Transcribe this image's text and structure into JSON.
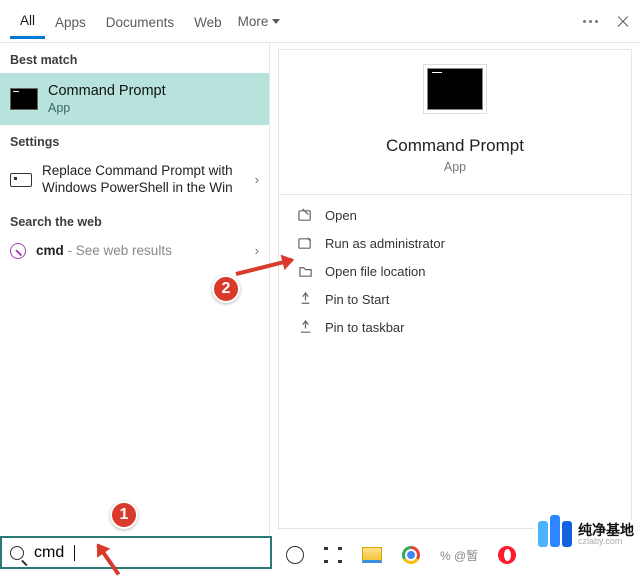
{
  "tabs": {
    "all": "All",
    "apps": "Apps",
    "documents": "Documents",
    "web": "Web",
    "more": "More"
  },
  "sections": {
    "best_match": "Best match",
    "settings": "Settings",
    "search_web": "Search the web"
  },
  "best": {
    "title": "Command Prompt",
    "sub": "App"
  },
  "setting_item": "Replace Command Prompt with Windows PowerShell in the Win",
  "web_item": {
    "term": "cmd",
    "dash": " - ",
    "tail": "See web results"
  },
  "detail": {
    "title": "Command Prompt",
    "sub": "App"
  },
  "actions": {
    "open": "Open",
    "run_admin": "Run as administrator",
    "open_loc": "Open file location",
    "pin_start": "Pin to Start",
    "pin_taskbar": "Pin to taskbar"
  },
  "search": {
    "value": "cmd"
  },
  "taskbar": {
    "baidu": "% @暂"
  },
  "watermark": {
    "t1": "纯净基地",
    "t2": "czlaby.com"
  },
  "badges": {
    "one": "1",
    "two": "2"
  }
}
